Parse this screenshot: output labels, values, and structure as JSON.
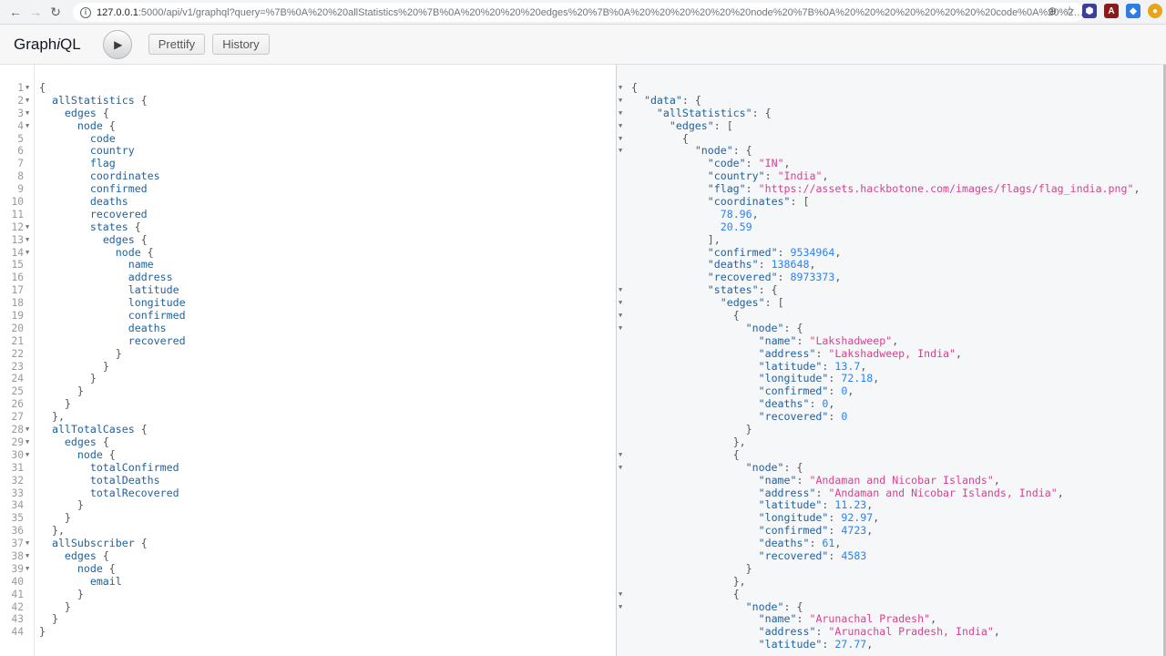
{
  "browser": {
    "back_icon": "arrow-left-icon",
    "forward_icon": "arrow-right-icon",
    "reload_icon": "reload-icon",
    "url_host": "127.0.0.1",
    "url_rest": ":5000/api/v1/graphql?query=%7B%0A%20%20allStatistics%20%7B%0A%20%20%20%20edges%20%7B%0A%20%20%20%20%20%20node%20%7B%0A%20%20%20%20%20%20%20%20code%0A%20%20%20%20%20%20%20%20..."
  },
  "toolbar": {
    "title_prefix": "Graph",
    "title_italic": "i",
    "title_suffix": "QL",
    "prettify_label": "Prettify",
    "history_label": "History"
  },
  "query_editor": {
    "lines": [
      {
        "num": "1",
        "fold": true,
        "text": "{"
      },
      {
        "num": "2",
        "fold": true,
        "text": "  allStatistics {"
      },
      {
        "num": "3",
        "fold": true,
        "text": "    edges {"
      },
      {
        "num": "4",
        "fold": true,
        "text": "      node {"
      },
      {
        "num": "5",
        "fold": false,
        "text": "        code"
      },
      {
        "num": "6",
        "fold": false,
        "text": "        country"
      },
      {
        "num": "7",
        "fold": false,
        "text": "        flag"
      },
      {
        "num": "8",
        "fold": false,
        "text": "        coordinates"
      },
      {
        "num": "9",
        "fold": false,
        "text": "        confirmed"
      },
      {
        "num": "10",
        "fold": false,
        "text": "        deaths"
      },
      {
        "num": "11",
        "fold": false,
        "text": "        recovered"
      },
      {
        "num": "12",
        "fold": true,
        "text": "        states {"
      },
      {
        "num": "13",
        "fold": true,
        "text": "          edges {"
      },
      {
        "num": "14",
        "fold": true,
        "text": "            node {"
      },
      {
        "num": "15",
        "fold": false,
        "text": "              name"
      },
      {
        "num": "16",
        "fold": false,
        "text": "              address"
      },
      {
        "num": "17",
        "fold": false,
        "text": "              latitude"
      },
      {
        "num": "18",
        "fold": false,
        "text": "              longitude"
      },
      {
        "num": "19",
        "fold": false,
        "text": "              confirmed"
      },
      {
        "num": "20",
        "fold": false,
        "text": "              deaths"
      },
      {
        "num": "21",
        "fold": false,
        "text": "              recovered"
      },
      {
        "num": "22",
        "fold": false,
        "text": "            }"
      },
      {
        "num": "23",
        "fold": false,
        "text": "          }"
      },
      {
        "num": "24",
        "fold": false,
        "text": "        }"
      },
      {
        "num": "25",
        "fold": false,
        "text": "      }"
      },
      {
        "num": "26",
        "fold": false,
        "text": "    }"
      },
      {
        "num": "27",
        "fold": false,
        "text": "  },"
      },
      {
        "num": "28",
        "fold": true,
        "text": "  allTotalCases {"
      },
      {
        "num": "29",
        "fold": true,
        "text": "    edges {"
      },
      {
        "num": "30",
        "fold": true,
        "text": "      node {"
      },
      {
        "num": "31",
        "fold": false,
        "text": "        totalConfirmed"
      },
      {
        "num": "32",
        "fold": false,
        "text": "        totalDeaths"
      },
      {
        "num": "33",
        "fold": false,
        "text": "        totalRecovered"
      },
      {
        "num": "34",
        "fold": false,
        "text": "      }"
      },
      {
        "num": "35",
        "fold": false,
        "text": "    }"
      },
      {
        "num": "36",
        "fold": false,
        "text": "  },"
      },
      {
        "num": "37",
        "fold": true,
        "text": "  allSubscriber {"
      },
      {
        "num": "38",
        "fold": true,
        "text": "    edges {"
      },
      {
        "num": "39",
        "fold": true,
        "text": "      node {"
      },
      {
        "num": "40",
        "fold": false,
        "text": "        email"
      },
      {
        "num": "41",
        "fold": false,
        "text": "      }"
      },
      {
        "num": "42",
        "fold": false,
        "text": "    }"
      },
      {
        "num": "43",
        "fold": false,
        "text": "  }"
      },
      {
        "num": "44",
        "fold": false,
        "text": "}"
      }
    ]
  },
  "result_viewer": {
    "lines": [
      {
        "fold": true,
        "text": "{"
      },
      {
        "fold": true,
        "text": "  \"data\": {"
      },
      {
        "fold": true,
        "text": "    \"allStatistics\": {"
      },
      {
        "fold": true,
        "text": "      \"edges\": ["
      },
      {
        "fold": true,
        "text": "        {"
      },
      {
        "fold": true,
        "text": "          \"node\": {"
      },
      {
        "fold": false,
        "text": "            \"code\": \"IN\","
      },
      {
        "fold": false,
        "text": "            \"country\": \"India\","
      },
      {
        "fold": false,
        "text": "            \"flag\": \"https://assets.hackbotone.com/images/flags/flag_india.png\","
      },
      {
        "fold": false,
        "text": "            \"coordinates\": ["
      },
      {
        "fold": false,
        "text": "              78.96,"
      },
      {
        "fold": false,
        "text": "              20.59"
      },
      {
        "fold": false,
        "text": "            ],"
      },
      {
        "fold": false,
        "text": "            \"confirmed\": 9534964,"
      },
      {
        "fold": false,
        "text": "            \"deaths\": 138648,"
      },
      {
        "fold": false,
        "text": "            \"recovered\": 8973373,"
      },
      {
        "fold": true,
        "text": "            \"states\": {"
      },
      {
        "fold": true,
        "text": "              \"edges\": ["
      },
      {
        "fold": true,
        "text": "                {"
      },
      {
        "fold": true,
        "text": "                  \"node\": {"
      },
      {
        "fold": false,
        "text": "                    \"name\": \"Lakshadweep\","
      },
      {
        "fold": false,
        "text": "                    \"address\": \"Lakshadweep, India\","
      },
      {
        "fold": false,
        "text": "                    \"latitude\": 13.7,"
      },
      {
        "fold": false,
        "text": "                    \"longitude\": 72.18,"
      },
      {
        "fold": false,
        "text": "                    \"confirmed\": 0,"
      },
      {
        "fold": false,
        "text": "                    \"deaths\": 0,"
      },
      {
        "fold": false,
        "text": "                    \"recovered\": 0"
      },
      {
        "fold": false,
        "text": "                  }"
      },
      {
        "fold": false,
        "text": "                },"
      },
      {
        "fold": true,
        "text": "                {"
      },
      {
        "fold": true,
        "text": "                  \"node\": {"
      },
      {
        "fold": false,
        "text": "                    \"name\": \"Andaman and Nicobar Islands\","
      },
      {
        "fold": false,
        "text": "                    \"address\": \"Andaman and Nicobar Islands, India\","
      },
      {
        "fold": false,
        "text": "                    \"latitude\": 11.23,"
      },
      {
        "fold": false,
        "text": "                    \"longitude\": 92.97,"
      },
      {
        "fold": false,
        "text": "                    \"confirmed\": 4723,"
      },
      {
        "fold": false,
        "text": "                    \"deaths\": 61,"
      },
      {
        "fold": false,
        "text": "                    \"recovered\": 4583"
      },
      {
        "fold": false,
        "text": "                  }"
      },
      {
        "fold": false,
        "text": "                },"
      },
      {
        "fold": true,
        "text": "                {"
      },
      {
        "fold": true,
        "text": "                  \"node\": {"
      },
      {
        "fold": false,
        "text": "                    \"name\": \"Arunachal Pradesh\","
      },
      {
        "fold": false,
        "text": "                    \"address\": \"Arunachal Pradesh, India\","
      },
      {
        "fold": false,
        "text": "                    \"latitude\": 27.77,"
      }
    ]
  }
}
